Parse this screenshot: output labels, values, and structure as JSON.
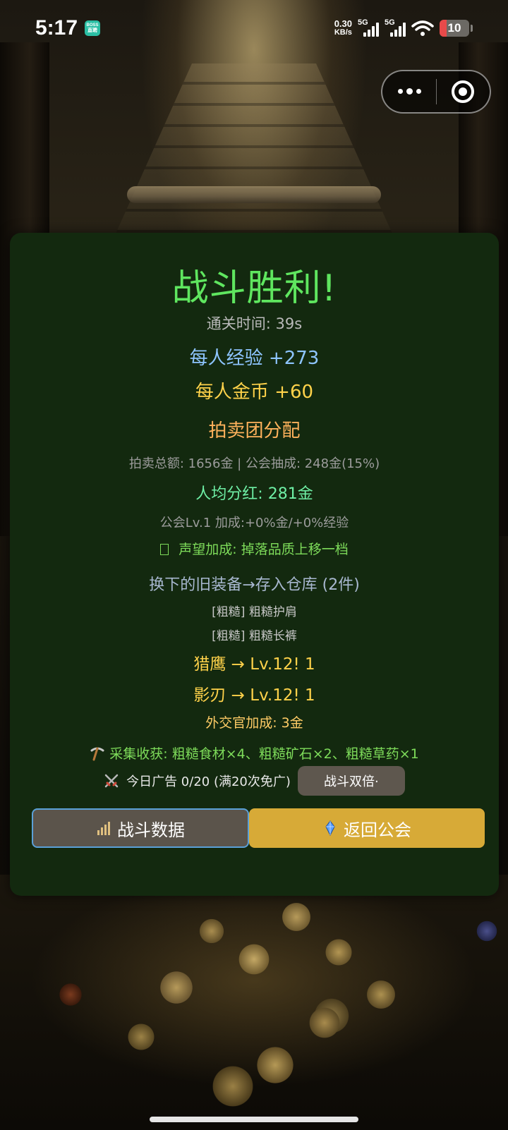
{
  "status_bar": {
    "time": "5:17",
    "app_badge_line1": "BOSS",
    "app_badge_line2": "直聘",
    "net_speed_value": "0.30",
    "net_speed_unit": "KB/s",
    "signal1_label": "5G",
    "signal2_label": "5G",
    "battery_level": "10",
    "wifi_icon": "wifi-icon",
    "battery_color": "#e84a4a"
  },
  "capsule": {
    "more_icon": "more-dots-icon",
    "close_icon": "target-close-icon"
  },
  "result": {
    "title": "战斗胜利!",
    "clear_time": "通关时间: 39s",
    "exp_per_person": "每人经验 +273",
    "gold_per_person": "每人金币 +60",
    "auction_title": "拍卖团分配",
    "auction_summary": "拍卖总额: 1656金 | 公会抽成: 248金(15%)",
    "dividend": "人均分红: 281金",
    "guild_bonus": "公会Lv.1 加成:+0%金/+0%经验",
    "reputation_bonus": "声望加成: 掉落品质上移一档",
    "old_gear_title": "换下的旧装备→存入仓库 (2件)",
    "old_gear_items": [
      "[粗糙] 粗糙护肩",
      "[粗糙] 粗糙长裤"
    ],
    "level_ups": [
      "猎鹰 → Lv.12! 1",
      "影刃 → Lv.12! 1"
    ],
    "diplomat_bonus": "外交官加成: 3金",
    "gather_harvest": "采集收获: 粗糙食材×4、粗糙矿石×2、粗糙草药×1",
    "ad_text": "今日广告 0/20 (满20次免广)",
    "double_button": "战斗双倍·",
    "stats_button": "战斗数据",
    "return_button": "返回公会"
  },
  "colors": {
    "panel_bg": "#13290f",
    "title_green": "#5fe65f",
    "exp_blue": "#8ec5ff",
    "gold_yellow": "#ffd24a",
    "auction_orange": "#ffb25c",
    "dividend_green": "#6ff0a6",
    "return_button_bg": "#d7aa37",
    "stats_button_bg": "#5b544b"
  }
}
